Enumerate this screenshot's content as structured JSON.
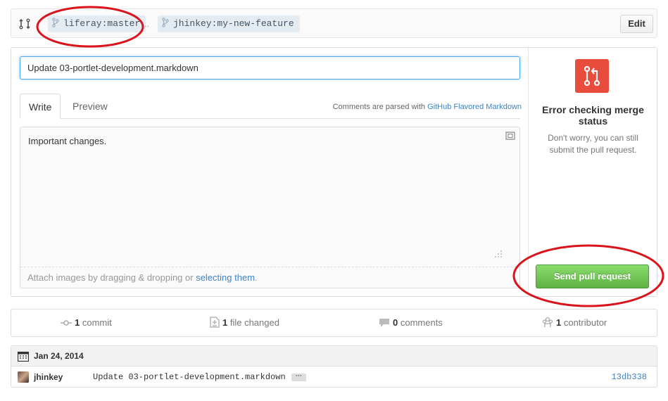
{
  "compare": {
    "base_branch": "liferay:master",
    "dots": "...",
    "head_branch": "jhinkey:my-new-feature",
    "edit_label": "Edit"
  },
  "form": {
    "title_value": "Update 03-portlet-development.markdown",
    "tab_write": "Write",
    "tab_preview": "Preview",
    "markdown_note_prefix": "Comments are parsed with ",
    "markdown_link": "GitHub Flavored Markdown",
    "comment_value": "Important changes.",
    "attach_prefix": "Attach images by dragging & dropping or ",
    "attach_link": "selecting them",
    "attach_suffix": "."
  },
  "merge": {
    "title": "Error checking merge status",
    "description": "Don't worry, you can still submit the pull request.",
    "send_label": "Send pull request",
    "icon": "git-pull-request-icon",
    "icon_color": "#e74c3c",
    "button_color": "#60b044"
  },
  "stats": {
    "commits_num": "1",
    "commits_label": " commit",
    "files_num": "1",
    "files_label": " file changed",
    "comments_num": "0",
    "comments_label": " comments",
    "contrib_num": "1",
    "contrib_label": " contributor"
  },
  "commits": {
    "date": "Jan 24, 2014",
    "rows": [
      {
        "author": "jhinkey",
        "message": "Update 03-portlet-development.markdown",
        "sha": "13db338"
      }
    ]
  },
  "colors": {
    "accent_link": "#4183c4",
    "annotation_red": "#d9141c"
  }
}
